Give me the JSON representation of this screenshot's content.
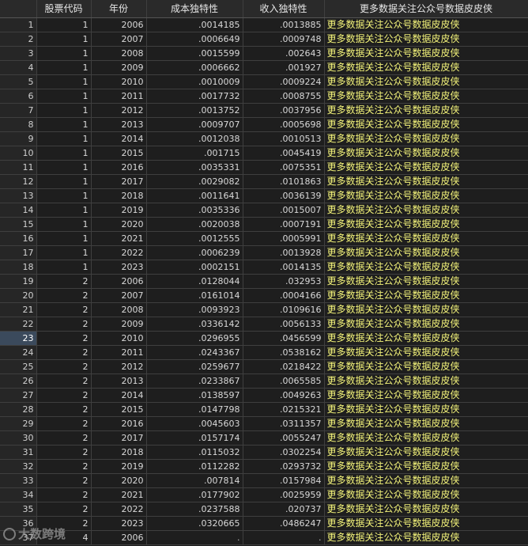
{
  "table": {
    "columns": [
      "",
      "股票代码",
      "年份",
      "成本独特性",
      "收入独特性",
      "更多数据关注公众号数据皮皮侠"
    ],
    "selected_row": "23",
    "rows": [
      [
        "1",
        "1",
        "2006",
        ".0014185",
        ".0013885",
        "更多数据关注公众号数据皮皮侠"
      ],
      [
        "2",
        "1",
        "2007",
        ".0006649",
        ".0009748",
        "更多数据关注公众号数据皮皮侠"
      ],
      [
        "3",
        "1",
        "2008",
        ".0015599",
        ".002643",
        "更多数据关注公众号数据皮皮侠"
      ],
      [
        "4",
        "1",
        "2009",
        ".0006662",
        ".001927",
        "更多数据关注公众号数据皮皮侠"
      ],
      [
        "5",
        "1",
        "2010",
        ".0010009",
        ".0009224",
        "更多数据关注公众号数据皮皮侠"
      ],
      [
        "6",
        "1",
        "2011",
        ".0017732",
        ".0008755",
        "更多数据关注公众号数据皮皮侠"
      ],
      [
        "7",
        "1",
        "2012",
        ".0013752",
        ".0037956",
        "更多数据关注公众号数据皮皮侠"
      ],
      [
        "8",
        "1",
        "2013",
        ".0009707",
        ".0005698",
        "更多数据关注公众号数据皮皮侠"
      ],
      [
        "9",
        "1",
        "2014",
        ".0012038",
        ".0010513",
        "更多数据关注公众号数据皮皮侠"
      ],
      [
        "10",
        "1",
        "2015",
        ".001715",
        ".0045419",
        "更多数据关注公众号数据皮皮侠"
      ],
      [
        "11",
        "1",
        "2016",
        ".0035331",
        ".0075351",
        "更多数据关注公众号数据皮皮侠"
      ],
      [
        "12",
        "1",
        "2017",
        ".0029082",
        ".0101863",
        "更多数据关注公众号数据皮皮侠"
      ],
      [
        "13",
        "1",
        "2018",
        ".0011641",
        ".0036139",
        "更多数据关注公众号数据皮皮侠"
      ],
      [
        "14",
        "1",
        "2019",
        ".0035336",
        ".0015007",
        "更多数据关注公众号数据皮皮侠"
      ],
      [
        "15",
        "1",
        "2020",
        ".0020038",
        ".0007191",
        "更多数据关注公众号数据皮皮侠"
      ],
      [
        "16",
        "1",
        "2021",
        ".0012555",
        ".0005991",
        "更多数据关注公众号数据皮皮侠"
      ],
      [
        "17",
        "1",
        "2022",
        ".0006239",
        ".0013928",
        "更多数据关注公众号数据皮皮侠"
      ],
      [
        "18",
        "1",
        "2023",
        ".0002151",
        ".0014135",
        "更多数据关注公众号数据皮皮侠"
      ],
      [
        "19",
        "2",
        "2006",
        ".0128044",
        ".032953",
        "更多数据关注公众号数据皮皮侠"
      ],
      [
        "20",
        "2",
        "2007",
        ".0161014",
        ".0004166",
        "更多数据关注公众号数据皮皮侠"
      ],
      [
        "21",
        "2",
        "2008",
        ".0093923",
        ".0109616",
        "更多数据关注公众号数据皮皮侠"
      ],
      [
        "22",
        "2",
        "2009",
        ".0336142",
        ".0056133",
        "更多数据关注公众号数据皮皮侠"
      ],
      [
        "23",
        "2",
        "2010",
        ".0296955",
        ".0456599",
        "更多数据关注公众号数据皮皮侠"
      ],
      [
        "24",
        "2",
        "2011",
        ".0243367",
        ".0538162",
        "更多数据关注公众号数据皮皮侠"
      ],
      [
        "25",
        "2",
        "2012",
        ".0259677",
        ".0218422",
        "更多数据关注公众号数据皮皮侠"
      ],
      [
        "26",
        "2",
        "2013",
        ".0233867",
        ".0065585",
        "更多数据关注公众号数据皮皮侠"
      ],
      [
        "27",
        "2",
        "2014",
        ".0138597",
        ".0049263",
        "更多数据关注公众号数据皮皮侠"
      ],
      [
        "28",
        "2",
        "2015",
        ".0147798",
        ".0215321",
        "更多数据关注公众号数据皮皮侠"
      ],
      [
        "29",
        "2",
        "2016",
        ".0045603",
        ".0311357",
        "更多数据关注公众号数据皮皮侠"
      ],
      [
        "30",
        "2",
        "2017",
        ".0157174",
        ".0055247",
        "更多数据关注公众号数据皮皮侠"
      ],
      [
        "31",
        "2",
        "2018",
        ".0115032",
        ".0302254",
        "更多数据关注公众号数据皮皮侠"
      ],
      [
        "32",
        "2",
        "2019",
        ".0112282",
        ".0293732",
        "更多数据关注公众号数据皮皮侠"
      ],
      [
        "33",
        "2",
        "2020",
        ".007814",
        ".0157984",
        "更多数据关注公众号数据皮皮侠"
      ],
      [
        "34",
        "2",
        "2021",
        ".0177902",
        ".0025959",
        "更多数据关注公众号数据皮皮侠"
      ],
      [
        "35",
        "2",
        "2022",
        ".0237588",
        ".020737",
        "更多数据关注公众号数据皮皮侠"
      ],
      [
        "36",
        "2",
        "2023",
        ".0320665",
        ".0486247",
        "更多数据关注公众号数据皮皮侠"
      ],
      [
        "37",
        "4",
        "2006",
        ".",
        ".",
        "更多数据关注公众号数据皮皮侠"
      ]
    ]
  },
  "watermark": {
    "text": "大数跨境"
  }
}
